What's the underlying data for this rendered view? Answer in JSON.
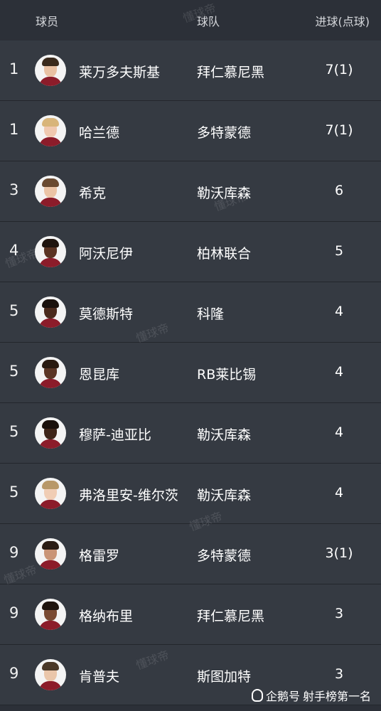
{
  "header": {
    "player_label": "球员",
    "team_label": "球队",
    "goals_label": "进球(点球)"
  },
  "rows": [
    {
      "rank": "1",
      "name": "莱万多夫斯基",
      "team": "拜仁慕尼黑",
      "goals": "7(1)",
      "skin": "#e9c1a3",
      "hair": "#3a2a1c"
    },
    {
      "rank": "1",
      "name": "哈兰德",
      "team": "多特蒙德",
      "goals": "7(1)",
      "skin": "#f0c9b0",
      "hair": "#d8b57a"
    },
    {
      "rank": "3",
      "name": "希克",
      "team": "勒沃库森",
      "goals": "6",
      "skin": "#ebc4a6",
      "hair": "#6a4a30"
    },
    {
      "rank": "4",
      "name": "阿沃尼伊",
      "team": "柏林联合",
      "goals": "5",
      "skin": "#5a3322",
      "hair": "#1f140e"
    },
    {
      "rank": "5",
      "name": "莫德斯特",
      "team": "科隆",
      "goals": "4",
      "skin": "#4a2a1c",
      "hair": "#1a110c"
    },
    {
      "rank": "5",
      "name": "恩昆库",
      "team": "RB莱比锡",
      "goals": "4",
      "skin": "#5b3524",
      "hair": "#2a1a10"
    },
    {
      "rank": "5",
      "name": "穆萨-迪亚比",
      "team": "勒沃库森",
      "goals": "4",
      "skin": "#3e2418",
      "hair": "#1a100b"
    },
    {
      "rank": "5",
      "name": "弗洛里安-维尔茨",
      "team": "勒沃库森",
      "goals": "4",
      "skin": "#f0cdb4",
      "hair": "#b89868"
    },
    {
      "rank": "9",
      "name": "格雷罗",
      "team": "多特蒙德",
      "goals": "3(1)",
      "skin": "#c99476",
      "hair": "#2a1c14"
    },
    {
      "rank": "9",
      "name": "格纳布里",
      "team": "拜仁慕尼黑",
      "goals": "3",
      "skin": "#7a4a32",
      "hair": "#1e140e"
    },
    {
      "rank": "9",
      "name": "肯普夫",
      "team": "斯图加特",
      "goals": "3",
      "skin": "#eac6aa",
      "hair": "#4a3828"
    }
  ],
  "watermark_text": "懂球帝",
  "footer": {
    "brand": "企鹅号",
    "account": "射手榜第一名"
  }
}
